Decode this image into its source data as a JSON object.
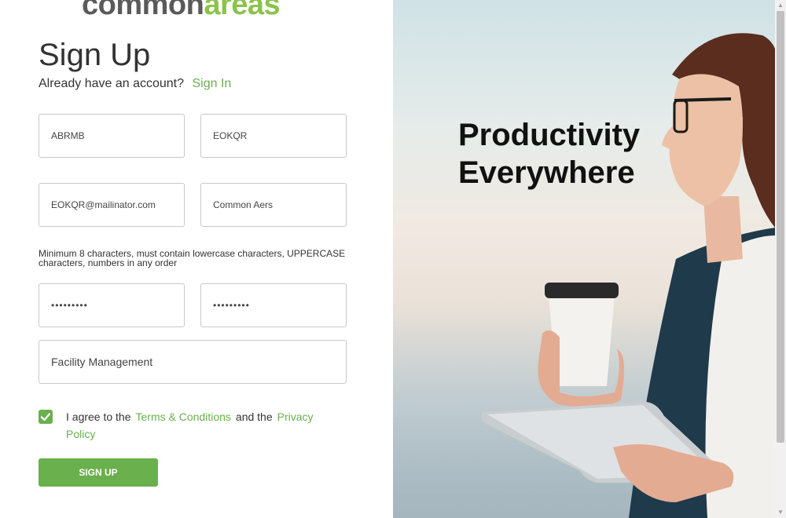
{
  "logo": {
    "word1": "common",
    "word2": "areas"
  },
  "form": {
    "title": "Sign Up",
    "already_text": "Already have an account?",
    "signin_link": "Sign In",
    "first_name_value": "ABRMB",
    "last_name_value": "EOKQR",
    "email_value": "EOKQR@mailinator.com",
    "organization_value": "Common Aers",
    "password_hint": "Minimum 8 characters, must contain lowercase characters, UPPERCASE characters, numbers in any order",
    "password_value": "•••••••••",
    "confirm_password_value": "•••••••••",
    "role_value": "Facility Management",
    "agree_prefix": "I agree to the",
    "terms_link": "Terms & Conditions",
    "agree_middle": "and the",
    "privacy_link": "Privacy Policy",
    "agree_checked": true,
    "signup_button": "SIGN UP"
  },
  "hero": {
    "headline_line1": "Productivity",
    "headline_line2": "Everywhere"
  },
  "colors": {
    "accent": "#6ab04c",
    "logo_gray": "#5a5a5a",
    "logo_green": "#8bc34a"
  }
}
